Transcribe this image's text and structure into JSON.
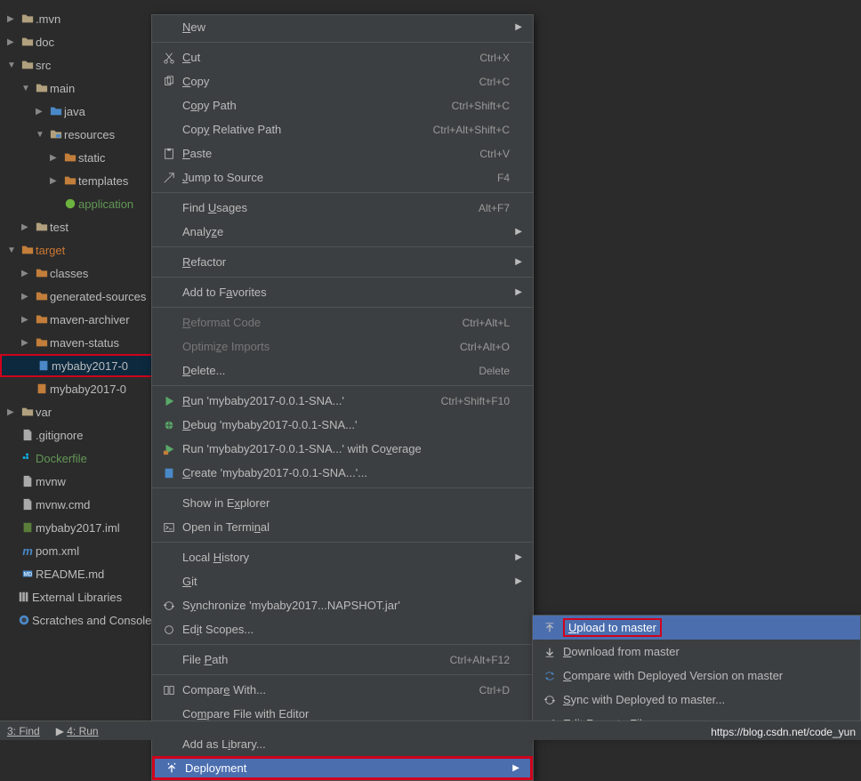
{
  "tree": {
    "items": [
      {
        "label": ".mvn",
        "indent": 0,
        "arrow": "▶",
        "iconType": "folder"
      },
      {
        "label": "doc",
        "indent": 0,
        "arrow": "▶",
        "iconType": "folder"
      },
      {
        "label": "src",
        "indent": 0,
        "arrow": "▼",
        "iconType": "folder"
      },
      {
        "label": "main",
        "indent": 1,
        "arrow": "▼",
        "iconType": "folder"
      },
      {
        "label": "java",
        "indent": 2,
        "arrow": "▶",
        "iconType": "folder-src"
      },
      {
        "label": "resources",
        "indent": 2,
        "arrow": "▼",
        "iconType": "folder-res"
      },
      {
        "label": "static",
        "indent": 3,
        "arrow": "▶",
        "iconType": "folder-gen"
      },
      {
        "label": "templates",
        "indent": 3,
        "arrow": "▶",
        "iconType": "folder-gen"
      },
      {
        "label": "application",
        "indent": 3,
        "arrow": "",
        "iconType": "spring",
        "green": true
      },
      {
        "label": "test",
        "indent": 1,
        "arrow": "▶",
        "iconType": "folder"
      },
      {
        "label": "target",
        "indent": 0,
        "arrow": "▼",
        "iconType": "folder-target"
      },
      {
        "label": "classes",
        "indent": 1,
        "arrow": "▶",
        "iconType": "folder-gen"
      },
      {
        "label": "generated-sources",
        "indent": 1,
        "arrow": "▶",
        "iconType": "folder-gen"
      },
      {
        "label": "maven-archiver",
        "indent": 1,
        "arrow": "▶",
        "iconType": "folder-gen"
      },
      {
        "label": "maven-status",
        "indent": 1,
        "arrow": "▶",
        "iconType": "folder-gen"
      },
      {
        "label": "mybaby2017-0",
        "indent": 1,
        "arrow": "",
        "iconType": "jar-blue",
        "selected": true
      },
      {
        "label": "mybaby2017-0",
        "indent": 1,
        "arrow": "",
        "iconType": "jar"
      },
      {
        "label": "var",
        "indent": 0,
        "arrow": "▶",
        "iconType": "folder"
      },
      {
        "label": ".gitignore",
        "indent": 0,
        "arrow": "",
        "iconType": "file"
      },
      {
        "label": "Dockerfile",
        "indent": 0,
        "arrow": "",
        "iconType": "docker",
        "green": true
      },
      {
        "label": "mvnw",
        "indent": 0,
        "arrow": "",
        "iconType": "file"
      },
      {
        "label": "mvnw.cmd",
        "indent": 0,
        "arrow": "",
        "iconType": "file"
      },
      {
        "label": "mybaby2017.iml",
        "indent": 0,
        "arrow": "",
        "iconType": "iml"
      },
      {
        "label": "pom.xml",
        "indent": 0,
        "arrow": "",
        "iconType": "maven"
      },
      {
        "label": "README.md",
        "indent": 0,
        "arrow": "",
        "iconType": "md"
      },
      {
        "label": "External Libraries",
        "indent": -1,
        "arrow": "",
        "iconType": "lib"
      },
      {
        "label": "Scratches and Consoles",
        "indent": -1,
        "arrow": "",
        "iconType": "scratch"
      }
    ]
  },
  "menu": [
    {
      "label_pre": "",
      "underline": "N",
      "label_post": "ew",
      "shortcut": "",
      "arrow": true,
      "icon": ""
    },
    {
      "sep": true
    },
    {
      "label_pre": "",
      "underline": "C",
      "label_post": "ut",
      "shortcut": "Ctrl+X",
      "icon": "cut"
    },
    {
      "label_pre": "",
      "underline": "C",
      "label_post": "opy",
      "shortcut": "Ctrl+C",
      "icon": "copy"
    },
    {
      "label_pre": "C",
      "underline": "o",
      "label_post": "py Path",
      "shortcut": "Ctrl+Shift+C",
      "icon": ""
    },
    {
      "label_pre": "Cop",
      "underline": "y",
      "label_post": " Relative Path",
      "shortcut": "Ctrl+Alt+Shift+C",
      "icon": ""
    },
    {
      "label_pre": "",
      "underline": "P",
      "label_post": "aste",
      "shortcut": "Ctrl+V",
      "icon": "paste"
    },
    {
      "label_pre": "",
      "underline": "J",
      "label_post": "ump to Source",
      "shortcut": "F4",
      "icon": "jump"
    },
    {
      "sep": true
    },
    {
      "label_pre": "Find ",
      "underline": "U",
      "label_post": "sages",
      "shortcut": "Alt+F7",
      "icon": ""
    },
    {
      "label_pre": "Analy",
      "underline": "z",
      "label_post": "e",
      "shortcut": "",
      "arrow": true,
      "icon": ""
    },
    {
      "sep": true
    },
    {
      "label_pre": "",
      "underline": "R",
      "label_post": "efactor",
      "shortcut": "",
      "arrow": true,
      "icon": ""
    },
    {
      "sep": true
    },
    {
      "label_pre": "Add to F",
      "underline": "a",
      "label_post": "vorites",
      "shortcut": "",
      "arrow": true,
      "icon": ""
    },
    {
      "sep": true
    },
    {
      "label_pre": "",
      "underline": "R",
      "label_post": "eformat Code",
      "shortcut": "Ctrl+Alt+L",
      "icon": "",
      "disabled": true
    },
    {
      "label_pre": "Optimi",
      "underline": "z",
      "label_post": "e Imports",
      "shortcut": "Ctrl+Alt+O",
      "icon": "",
      "disabled": true
    },
    {
      "label_pre": "",
      "underline": "D",
      "label_post": "elete...",
      "shortcut": "Delete",
      "icon": ""
    },
    {
      "sep": true
    },
    {
      "label_pre": "",
      "underline": "R",
      "label_post": "un 'mybaby2017-0.0.1-SNA...'",
      "shortcut": "Ctrl+Shift+F10",
      "icon": "run"
    },
    {
      "label_pre": "",
      "underline": "D",
      "label_post": "ebug 'mybaby2017-0.0.1-SNA...'",
      "shortcut": "",
      "icon": "debug"
    },
    {
      "label_pre": "Run 'mybaby2017-0.0.1-SNA...' with Co",
      "underline": "v",
      "label_post": "erage",
      "shortcut": "",
      "icon": "coverage"
    },
    {
      "label_pre": "",
      "underline": "C",
      "label_post": "reate 'mybaby2017-0.0.1-SNA...'...",
      "shortcut": "",
      "icon": "create"
    },
    {
      "sep": true
    },
    {
      "label_pre": "Show in E",
      "underline": "x",
      "label_post": "plorer",
      "shortcut": "",
      "icon": ""
    },
    {
      "label_pre": "Open in Termi",
      "underline": "n",
      "label_post": "al",
      "shortcut": "",
      "icon": "terminal"
    },
    {
      "sep": true
    },
    {
      "label_pre": "Local ",
      "underline": "H",
      "label_post": "istory",
      "shortcut": "",
      "arrow": true,
      "icon": ""
    },
    {
      "label_pre": "",
      "underline": "G",
      "label_post": "it",
      "shortcut": "",
      "arrow": true,
      "icon": ""
    },
    {
      "label_pre": "S",
      "underline": "y",
      "label_post": "nchronize 'mybaby2017...NAPSHOT.jar'",
      "shortcut": "",
      "icon": "sync"
    },
    {
      "label_pre": "Ed",
      "underline": "i",
      "label_post": "t Scopes...",
      "shortcut": "",
      "icon": "edit"
    },
    {
      "sep": true
    },
    {
      "label_pre": "File ",
      "underline": "P",
      "label_post": "ath",
      "shortcut": "Ctrl+Alt+F12",
      "icon": ""
    },
    {
      "sep": true
    },
    {
      "label_pre": "Compar",
      "underline": "e",
      "label_post": " With...",
      "shortcut": "Ctrl+D",
      "icon": "compare"
    },
    {
      "label_pre": "Co",
      "underline": "m",
      "label_post": "pare File with Editor",
      "shortcut": "",
      "icon": ""
    },
    {
      "sep": true
    },
    {
      "label_pre": "Add as L",
      "underline": "i",
      "label_post": "brary...",
      "shortcut": "",
      "icon": ""
    },
    {
      "label_pre": "Deployment",
      "underline": "",
      "label_post": "",
      "shortcut": "",
      "arrow": true,
      "icon": "deploy",
      "highlighted": true,
      "boxed": true
    }
  ],
  "submenu": [
    {
      "label_pre": "",
      "underline": "U",
      "label_post": "pload to master",
      "icon": "upload",
      "highlighted": true,
      "boxed": true
    },
    {
      "label_pre": "",
      "underline": "D",
      "label_post": "ownload from master",
      "icon": "download"
    },
    {
      "label_pre": "",
      "underline": "C",
      "label_post": "ompare with Deployed Version on master",
      "icon": "sync2"
    },
    {
      "label_pre": "",
      "underline": "S",
      "label_post": "ync with Deployed to master...",
      "icon": "sync3"
    },
    {
      "label_pre": "Edit Re",
      "underline": "m",
      "label_post": "ote File",
      "icon": "edit2"
    }
  ],
  "statusbar": {
    "find": "3: Find",
    "run": "4: Run"
  },
  "watermark": "https://blog.csdn.net/code_yun"
}
